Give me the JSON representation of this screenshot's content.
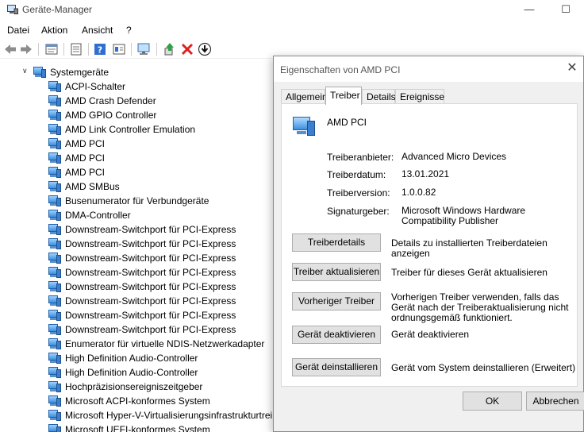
{
  "window": {
    "title": "Geräte-Manager"
  },
  "menu": [
    "Datei",
    "Aktion",
    "Ansicht",
    "?"
  ],
  "toolbar": {
    "icons": [
      "back-arrow",
      "forward-arrow",
      "properties",
      "help",
      "scan-hardware",
      "monitor",
      "update-driver",
      "uninstall-x",
      "download"
    ]
  },
  "tree": {
    "root": "Systemgeräte",
    "items": [
      "ACPI-Schalter",
      "AMD Crash Defender",
      "AMD GPIO Controller",
      "AMD Link Controller Emulation",
      "AMD PCI",
      "AMD PCI",
      "AMD PCI",
      "AMD SMBus",
      "Busenumerator für Verbundgeräte",
      "DMA-Controller",
      "Downstream-Switchport für PCI-Express",
      "Downstream-Switchport für PCI-Express",
      "Downstream-Switchport für PCI-Express",
      "Downstream-Switchport für PCI-Express",
      "Downstream-Switchport für PCI-Express",
      "Downstream-Switchport für PCI-Express",
      "Downstream-Switchport für PCI-Express",
      "Downstream-Switchport für PCI-Express",
      "Enumerator für virtuelle NDIS-Netzwerkadapter",
      "High Definition Audio-Controller",
      "High Definition Audio-Controller",
      "Hochpräzisionsereigniszeitgeber",
      "Microsoft ACPI-konformes System",
      "Microsoft Hyper-V-Virtualisierungsinfrastrukturtreiber",
      "Microsoft UEFI-konformes System"
    ]
  },
  "dialog": {
    "title": "Eigenschaften von AMD PCI",
    "tabs": [
      "Allgemein",
      "Treiber",
      "Details",
      "Ereignisse"
    ],
    "active_tab": "Treiber",
    "device_name": "AMD PCI",
    "props": {
      "provider_label": "Treiberanbieter:",
      "provider": "Advanced Micro Devices",
      "date_label": "Treiberdatum:",
      "date": "13.01.2021",
      "version_label": "Treiberversion:",
      "version": "1.0.0.82",
      "signer_label": "Signaturgeber:",
      "signer": "Microsoft Windows Hardware Compatibility Publisher"
    },
    "buttons": {
      "details": "Treiberdetails",
      "details_desc": "Details zu installierten Treiberdateien anzeigen",
      "update": "Treiber aktualisieren",
      "update_desc": "Treiber für dieses Gerät aktualisieren",
      "rollback": "Vorheriger Treiber",
      "rollback_desc": "Vorherigen Treiber verwenden, falls das Gerät nach der Treiberaktualisierung nicht ordnungsgemäß funktioniert.",
      "disable": "Gerät deaktivieren",
      "disable_desc": "Gerät deaktivieren",
      "uninstall": "Gerät deinstallieren",
      "uninstall_desc": "Gerät vom System deinstallieren (Erweitert)",
      "ok": "OK",
      "cancel": "Abbrechen"
    }
  }
}
